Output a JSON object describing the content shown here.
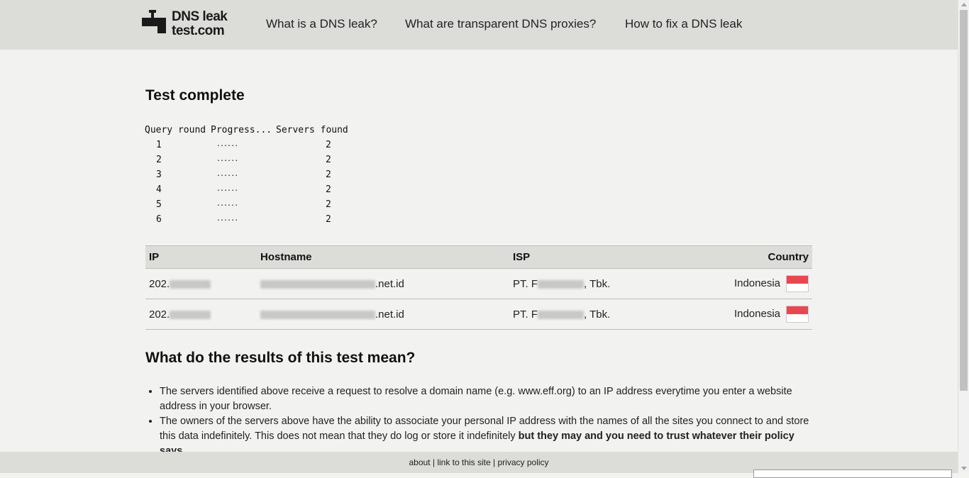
{
  "header": {
    "logo": {
      "line1": "DNS leak",
      "line2": "test.com"
    },
    "nav": [
      {
        "label": "What is a DNS leak?"
      },
      {
        "label": "What are transparent DNS proxies?"
      },
      {
        "label": "How to fix a DNS leak"
      }
    ]
  },
  "test": {
    "title": "Test complete",
    "columns": {
      "round": "Query round",
      "progress": "Progress...",
      "found": "Servers found"
    },
    "rounds": [
      {
        "round": "1",
        "progress": "......",
        "found": "2"
      },
      {
        "round": "2",
        "progress": "......",
        "found": "2"
      },
      {
        "round": "3",
        "progress": "......",
        "found": "2"
      },
      {
        "round": "4",
        "progress": "......",
        "found": "2"
      },
      {
        "round": "5",
        "progress": "......",
        "found": "2"
      },
      {
        "round": "6",
        "progress": "......",
        "found": "2"
      }
    ]
  },
  "results": {
    "headers": {
      "ip": "IP",
      "hostname": "Hostname",
      "isp": "ISP",
      "country": "Country"
    },
    "rows": [
      {
        "ip_prefix": "202.",
        "hostname_suffix": ".net.id",
        "isp_prefix": "PT. F",
        "isp_suffix": ", Tbk.",
        "country": "Indonesia",
        "flag_icon": "indonesia-flag-icon"
      },
      {
        "ip_prefix": "202.",
        "hostname_suffix": ".net.id",
        "isp_prefix": "PT. F",
        "isp_suffix": ", Tbk.",
        "country": "Indonesia",
        "flag_icon": "indonesia-flag-icon"
      }
    ]
  },
  "explanation": {
    "title": "What do the results of this test mean?",
    "bullets": [
      {
        "text": "The servers identified above receive a request to resolve a domain name (e.g. www.eff.org) to an IP address everytime you enter a website address in your browser."
      },
      {
        "text": "The owners of the servers above have the ability to associate your personal IP address with the names of all the sites you connect to and store this data indefinitely. This does not mean that they do log or store it indefinitely ",
        "bold": "but they may and you need to trust whatever their policy says."
      }
    ]
  },
  "footer": {
    "about": "about",
    "link": "link to this site",
    "privacy": "privacy policy",
    "separator": "|"
  },
  "colors": {
    "header_bg": "#dcdcd8",
    "page_bg": "#f2f2f0",
    "flag_red": "#e8474f"
  }
}
